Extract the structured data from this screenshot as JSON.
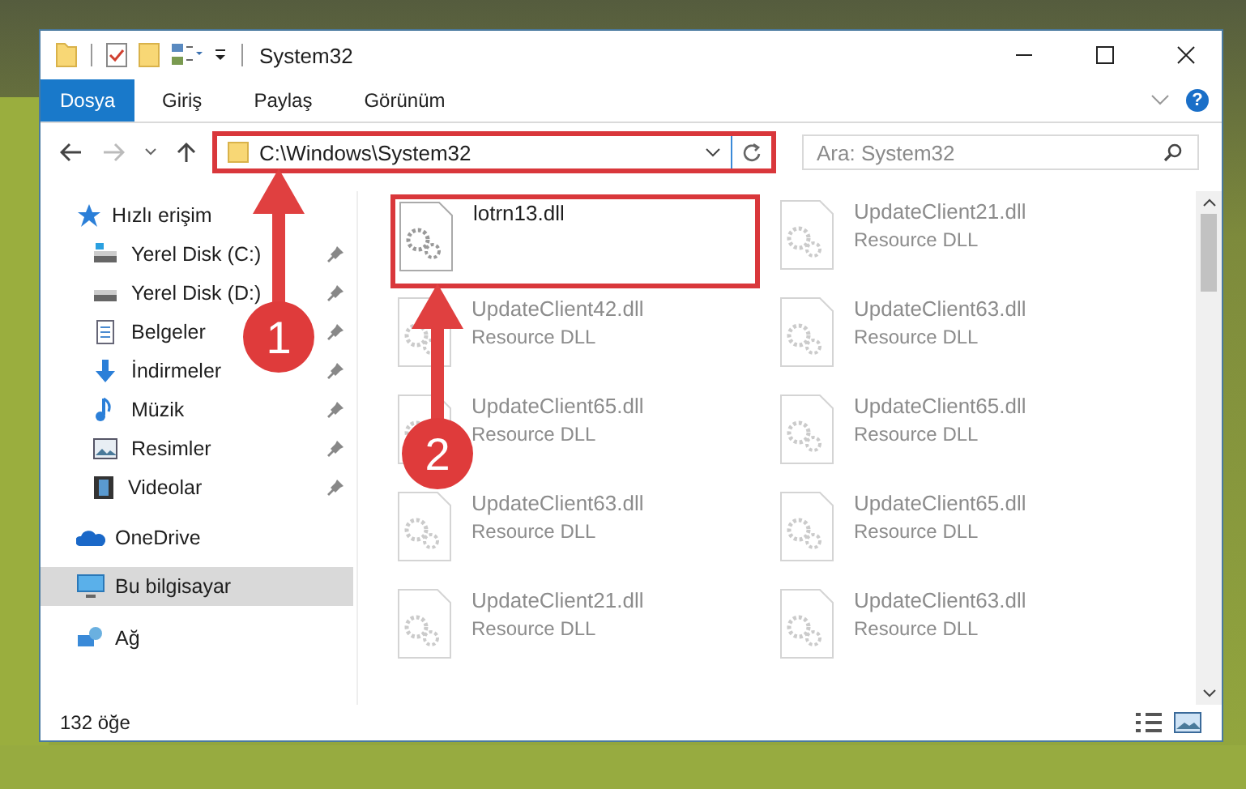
{
  "window": {
    "title": "System32"
  },
  "ribbon": {
    "tabs": [
      {
        "label": "Dosya",
        "selected": true
      },
      {
        "label": "Giriş",
        "selected": false
      },
      {
        "label": "Paylaş",
        "selected": false
      },
      {
        "label": "Görünüm",
        "selected": false
      }
    ],
    "help": "?"
  },
  "address_bar": {
    "path": "C:\\Windows\\System32",
    "highlighted": true
  },
  "search": {
    "placeholder": "Ara: System32"
  },
  "sidebar": {
    "items": [
      {
        "label": "Hızlı erişim",
        "selected": false,
        "children": [
          {
            "label": "Yerel Disk (C:)",
            "pinned": true
          },
          {
            "label": "Yerel Disk (D:)",
            "pinned": true
          },
          {
            "label": "Belgeler",
            "pinned": true
          },
          {
            "label": "İndirmeler",
            "pinned": true
          },
          {
            "label": "Müzik",
            "pinned": true
          },
          {
            "label": "Resimler",
            "pinned": true
          },
          {
            "label": "Videolar",
            "pinned": true
          }
        ]
      },
      {
        "label": "OneDrive",
        "selected": false
      },
      {
        "label": "Bu bilgisayar",
        "selected": true
      },
      {
        "label": "Ağ",
        "selected": false
      }
    ]
  },
  "files": [
    {
      "name": "lotrn13.dll",
      "blurred": false,
      "highlighted": true
    },
    {
      "name": "UpdateClient21.dll",
      "type": "Resource DLL",
      "blurred": true,
      "highlighted": false
    },
    {
      "name": "UpdateClient42.dll",
      "type": "Resource DLL",
      "blurred": true,
      "highlighted": false
    },
    {
      "name": "UpdateClient63.dll",
      "type": "Resource DLL",
      "blurred": true,
      "highlighted": false
    },
    {
      "name": "UpdateClient65.dll",
      "type": "Resource DLL",
      "blurred": true,
      "highlighted": false
    },
    {
      "name": "UpdateClient65.dll",
      "type": "Resource DLL",
      "blurred": true,
      "highlighted": false
    },
    {
      "name": "UpdateClient63.dll",
      "type": "Resource DLL",
      "blurred": true,
      "highlighted": false
    },
    {
      "name": "UpdateClient65.dll",
      "type": "Resource DLL",
      "blurred": true,
      "highlighted": false
    },
    {
      "name": "UpdateClient21.dll",
      "type": "Resource DLL",
      "blurred": true,
      "highlighted": false
    },
    {
      "name": "UpdateClient63.dll",
      "type": "Resource DLL",
      "blurred": true,
      "highlighted": false
    }
  ],
  "status_bar": {
    "count": "132 öğe"
  },
  "annotations": [
    {
      "label": "1"
    },
    {
      "label": "2"
    }
  ]
}
